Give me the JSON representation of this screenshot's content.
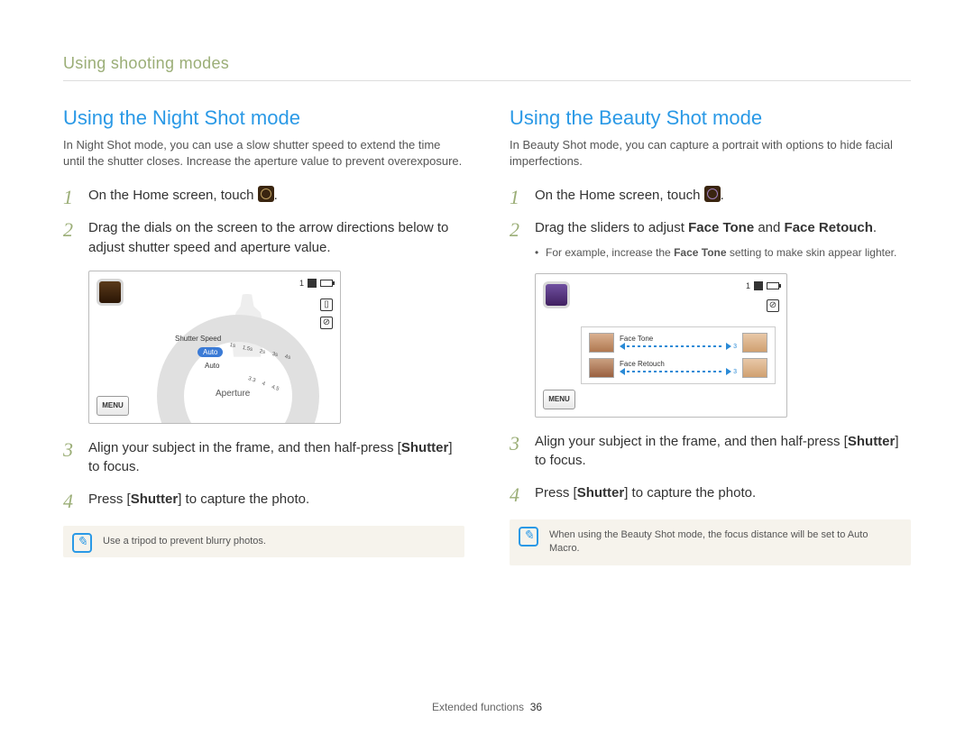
{
  "breadcrumb": "Using shooting modes",
  "footer": {
    "section": "Extended functions",
    "page": "36"
  },
  "left": {
    "title": "Using the Night Shot mode",
    "intro": "In Night Shot mode, you can use a slow shutter speed to extend the time until the shutter closes. Increase the aperture value to prevent overexposure.",
    "step1_a": "On the Home screen, touch ",
    "step1_b": ".",
    "step2": "Drag the dials on the screen to the arrow directions below to adjust shutter speed and aperture value.",
    "step3_a": "Align your subject in the frame, and then half-press [",
    "step3_bold": "Shutter",
    "step3_b": "] to focus.",
    "step4_a": "Press [",
    "step4_bold": "Shutter",
    "step4_b": "] to capture the photo.",
    "tip": "Use a tripod to prevent blurry photos.",
    "screen": {
      "statusNum": "1",
      "menu": "MENU",
      "shutterSpeedLabel": "Shutter Speed",
      "apertureLabel": "Aperture",
      "auto": "Auto",
      "tick1s": "1s",
      "tick15s": "1.5s",
      "tick2s": "2s",
      "tick3s": "3s",
      "tick4s": "4s",
      "ap33": "3.3",
      "ap4": "4",
      "ap45": "4.5"
    }
  },
  "right": {
    "title": "Using the Beauty Shot mode",
    "intro": "In Beauty Shot mode, you can capture a portrait with options to hide facial imperfections.",
    "step1_a": "On the Home screen, touch ",
    "step1_b": ".",
    "step2_a": "Drag the sliders to adjust ",
    "step2_bold1": "Face Tone",
    "step2_mid": " and ",
    "step2_bold2": "Face Retouch",
    "step2_b": ".",
    "sub_a": "For example, increase the ",
    "sub_bold": "Face Tone",
    "sub_b": " setting to make skin appear lighter.",
    "step3_a": "Align your subject in the frame, and then half-press [",
    "step3_bold": "Shutter",
    "step3_b": "] to focus.",
    "step4_a": "Press [",
    "step4_bold": "Shutter",
    "step4_b": "] to capture the photo.",
    "tip": "When using the Beauty Shot mode, the focus distance will be set to Auto Macro.",
    "screen": {
      "statusNum": "1",
      "menu": "MENU",
      "faceTone": "Face Tone",
      "faceRetouch": "Face Retouch",
      "rangeEnd": "3"
    }
  }
}
